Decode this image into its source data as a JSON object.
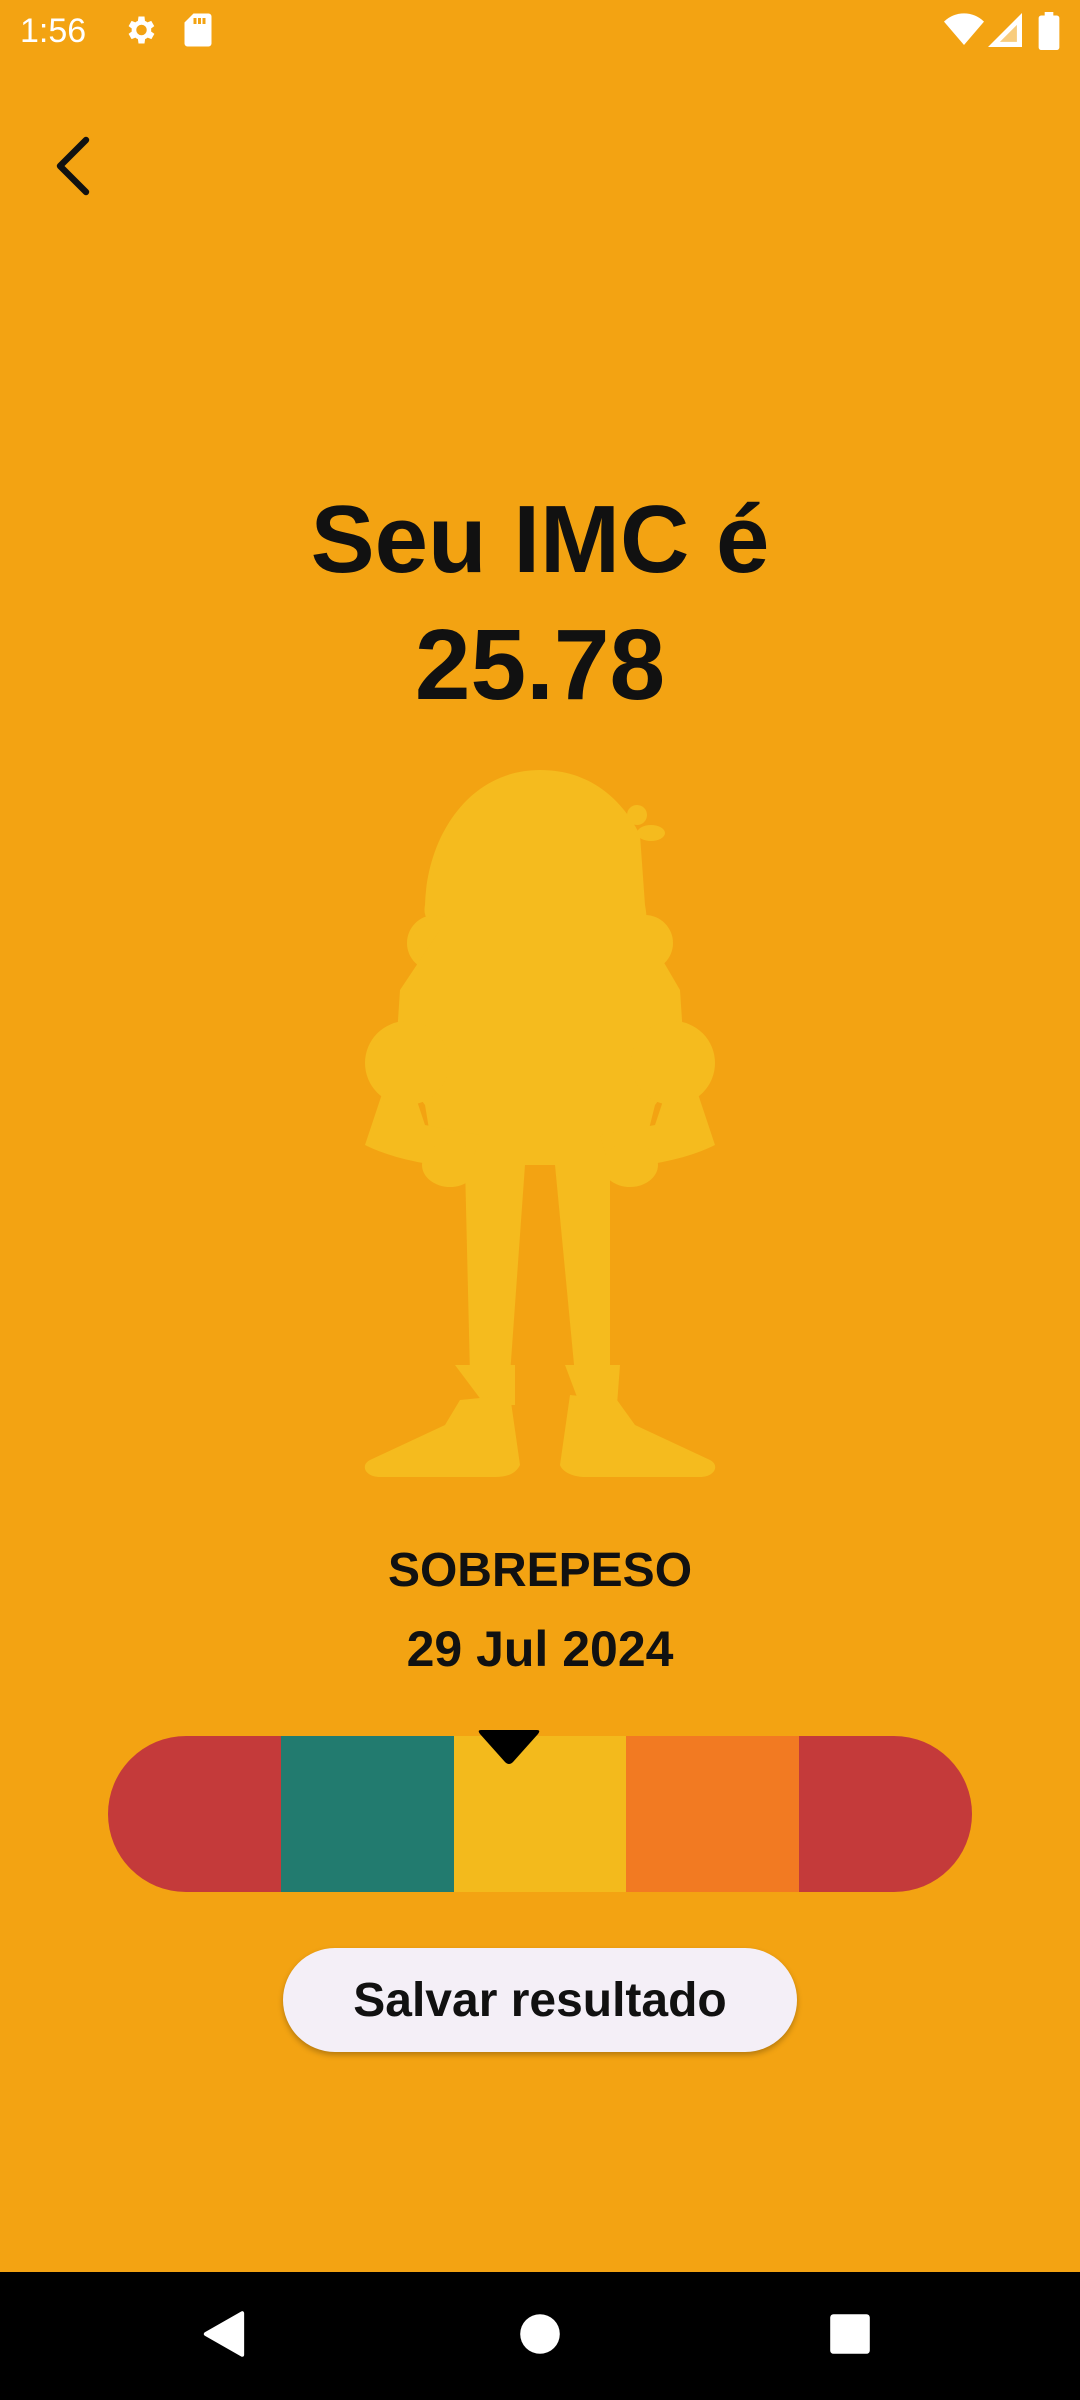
{
  "status_bar": {
    "time": "1:56",
    "icons": [
      "settings-icon",
      "sd-card-icon",
      "wifi-icon",
      "signal-icon",
      "battery-icon"
    ]
  },
  "back_icon": "chevron-left-icon",
  "result": {
    "title": "Seu IMC é",
    "value": "25.78",
    "category": "SOBREPESO",
    "date": "29 Jul 2024"
  },
  "scale": {
    "segments": [
      {
        "color": "#C43A3A"
      },
      {
        "color": "#227B6F"
      },
      {
        "color": "#F3BA1C"
      },
      {
        "color": "#F27A22"
      },
      {
        "color": "#C43A3A"
      }
    ],
    "active_segment": 3
  },
  "save_button": {
    "label": "Salvar resultado"
  },
  "colors": {
    "background": "#F3A312",
    "silhouette": "#F5BB1E"
  },
  "nav_bar": {
    "icons": [
      "back-triangle-icon",
      "home-circle-icon",
      "recents-square-icon"
    ]
  }
}
